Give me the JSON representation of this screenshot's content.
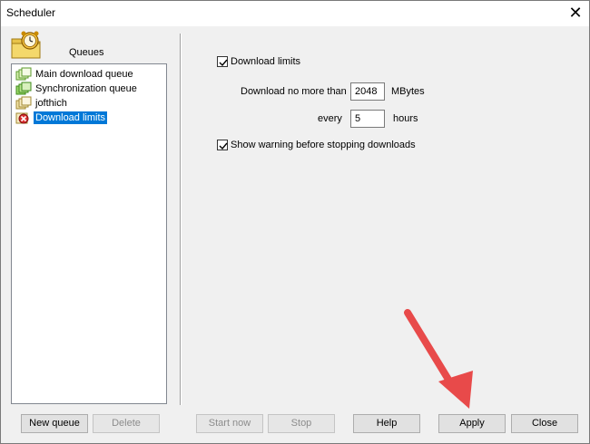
{
  "window": {
    "title": "Scheduler",
    "close_glyph": "✕"
  },
  "queues": {
    "header": "Queues",
    "items": [
      {
        "label": "Main download queue",
        "icon": "queue-icon",
        "selected": false
      },
      {
        "label": "Synchronization queue",
        "icon": "sync-queue-icon",
        "selected": false
      },
      {
        "label": "jofthich",
        "icon": "queue-icon",
        "selected": false
      },
      {
        "label": "Download limits",
        "icon": "limit-queue-icon",
        "selected": true
      }
    ]
  },
  "limits": {
    "download_limits_label": "Download limits",
    "download_limits_checked": true,
    "no_more_than_label": "Download no more than",
    "amount_value": "2048",
    "amount_unit": "MBytes",
    "every_label": "every",
    "every_value": "5",
    "every_unit": "hours",
    "show_warning_label": "Show warning before stopping downloads",
    "show_warning_checked": true
  },
  "buttons": {
    "new_queue": "New queue",
    "delete": "Delete",
    "start_now": "Start now",
    "stop": "Stop",
    "help": "Help",
    "apply": "Apply",
    "close": "Close"
  },
  "colors": {
    "selection": "#0078d7",
    "annotation_arrow": "#e84a4a"
  }
}
